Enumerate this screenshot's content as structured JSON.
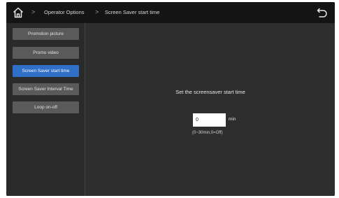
{
  "header": {
    "breadcrumb": [
      "Operator Options",
      "Screen Saver start time"
    ],
    "separator": ">"
  },
  "sidebar": {
    "items": [
      {
        "label": "Promotion picture",
        "active": false
      },
      {
        "label": "Promo video",
        "active": false
      },
      {
        "label": "Screen Saver start time",
        "active": true
      },
      {
        "label": "Screen Saver Interval Time",
        "active": false
      },
      {
        "label": "Loop on-off",
        "active": false
      }
    ]
  },
  "main": {
    "prompt": "Set the screensaver start time",
    "value": "0",
    "unit": "min",
    "range_hint": "(0~30min,0=Off)"
  },
  "colors": {
    "active": "#2f6fc7",
    "button": "#5a5a5a",
    "topbar": "#141414",
    "background": "#2e2e2e"
  }
}
